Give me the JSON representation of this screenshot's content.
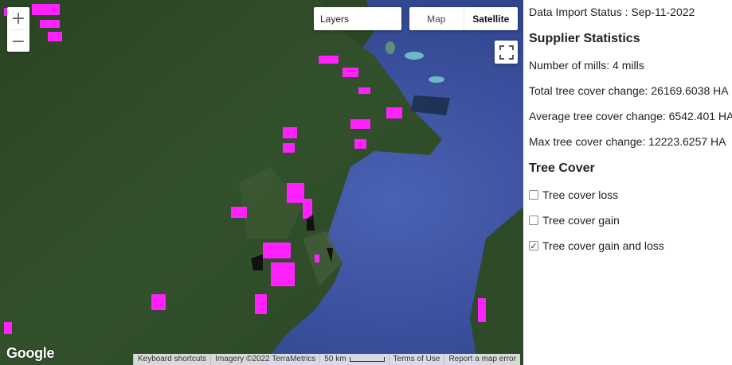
{
  "map": {
    "zoom_in_label": "+",
    "zoom_out_label": "−",
    "layers_label": "Layers",
    "map_types": [
      {
        "label": "Map",
        "active": false
      },
      {
        "label": "Satellite",
        "active": true
      }
    ],
    "logo_text": "Google",
    "footer": {
      "shortcuts": "Keyboard shortcuts",
      "imagery": "Imagery ©2022 TerraMetrics",
      "scale_label": "50 km",
      "terms": "Terms of Use",
      "report": "Report a map error"
    },
    "colors": {
      "overlay": "#ff22ff",
      "land": "#2f4a27",
      "ocean": "#3f56a8"
    }
  },
  "panel": {
    "import_status": "Data Import Status : Sep-11-2022",
    "supplier_heading": "Supplier Statistics",
    "stats": [
      "Number of mills: 4 mills",
      "Total tree cover change: 26169.6038 HA",
      "Average tree cover change: 6542.401 HA",
      "Max tree cover change: 12223.6257 HA"
    ],
    "tree_cover_heading": "Tree Cover",
    "options": [
      {
        "label": "Tree cover loss",
        "checked": false
      },
      {
        "label": "Tree cover gain",
        "checked": false
      },
      {
        "label": "Tree cover gain and loss",
        "checked": true
      }
    ]
  }
}
